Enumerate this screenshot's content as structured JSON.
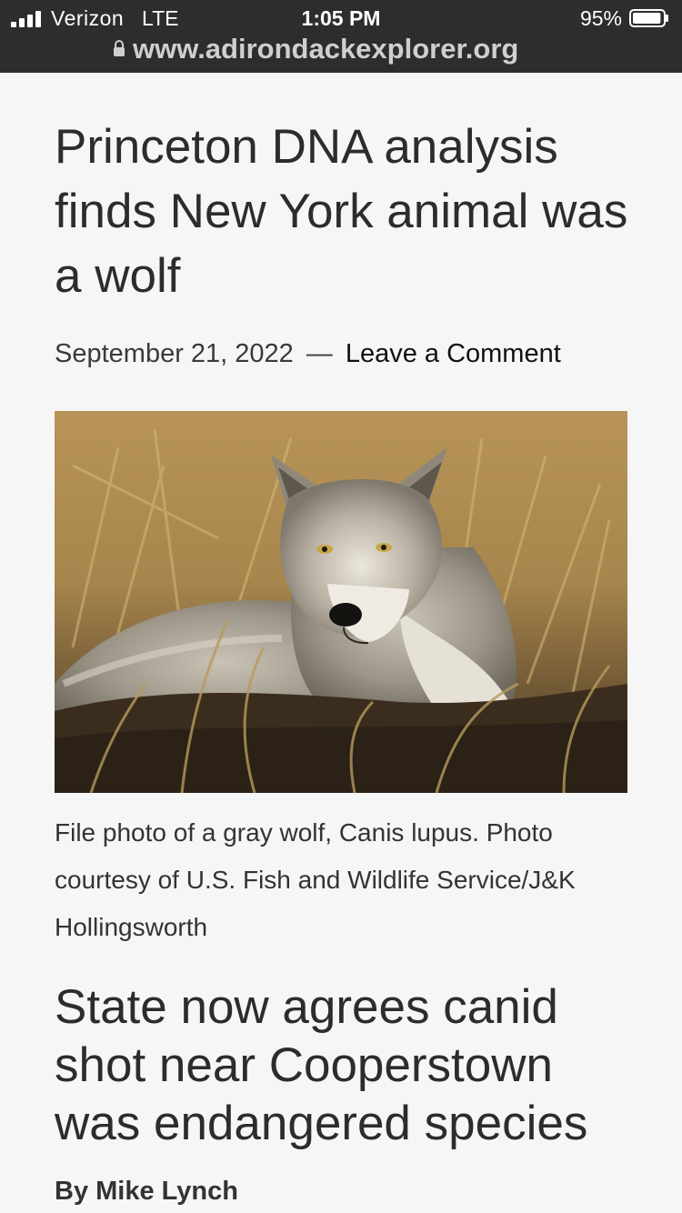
{
  "status_bar": {
    "carrier": "Verizon",
    "network": "LTE",
    "time": "1:05 PM",
    "battery_percent": "95%",
    "battery_level": 0.95
  },
  "browser": {
    "url": "www.adirondackexplorer.org"
  },
  "article": {
    "headline": "Princeton DNA analysis finds New York animal was a wolf",
    "date": "September 21, 2022",
    "separator": "—",
    "comment_link": "Leave a Comment",
    "image_caption": "File photo of a gray wolf, Canis lupus. Photo courtesy of U.S. Fish and Wildlife Service/J&K Hollingsworth",
    "subheadline": "State now agrees canid shot near Cooperstown was endangered species",
    "byline": "By Mike Lynch"
  },
  "icons": {
    "signal": "signal-bars-icon",
    "battery": "battery-icon",
    "lock": "lock-icon"
  }
}
